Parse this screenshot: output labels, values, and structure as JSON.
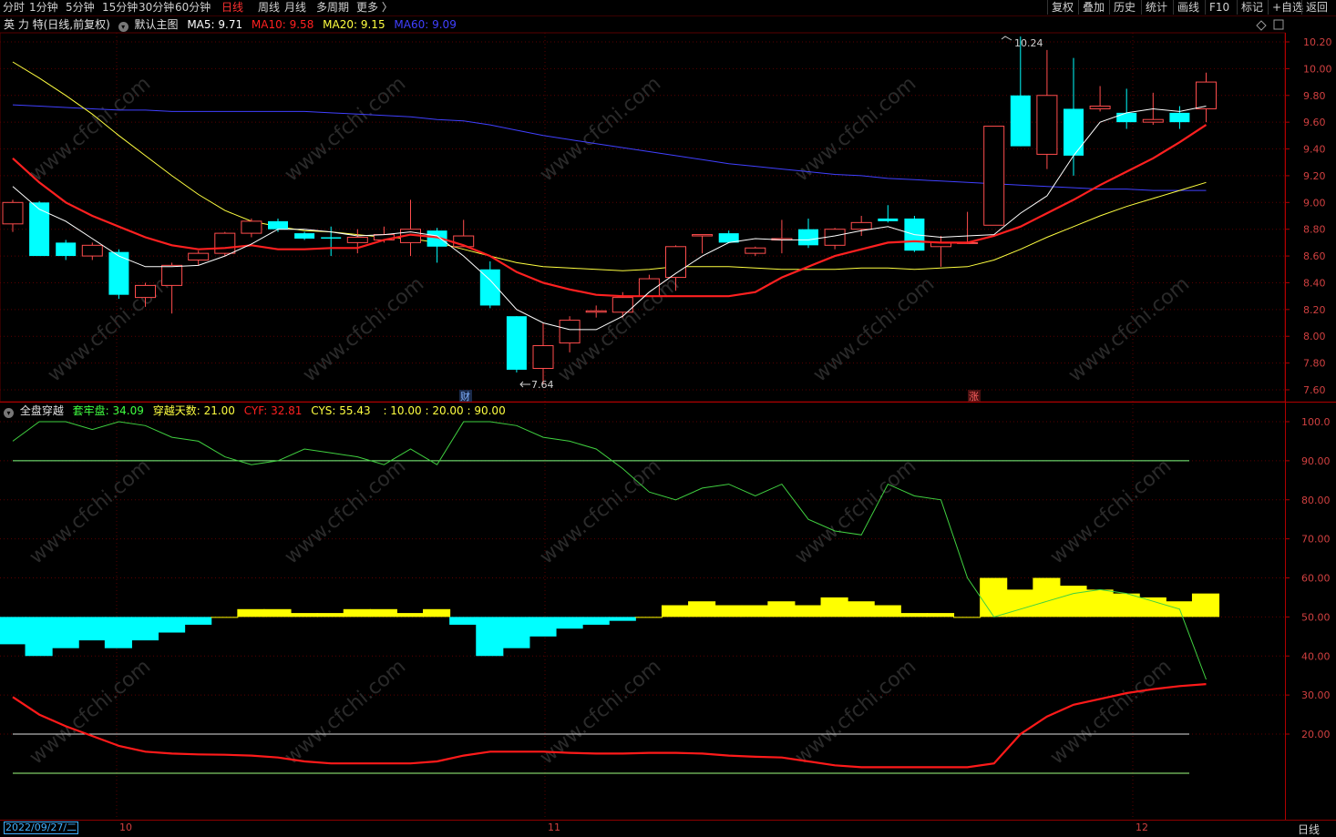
{
  "toolbar": {
    "periods": [
      "分时",
      "1分钟",
      "5分钟",
      "15分钟",
      "30分钟",
      "60分钟",
      "日线",
      "周线",
      "月线",
      "多周期",
      "更多 〉"
    ],
    "active_period": "日线",
    "right_buttons": [
      "复权",
      "叠加",
      "历史",
      "统计",
      "画线",
      "F10",
      "标记",
      "+自选",
      "返回"
    ]
  },
  "main_header": {
    "stock": "英 力 特(日线,前复权)",
    "template": "默认主图",
    "ma5": "MA5: 9.71",
    "ma10": "MA10: 9.58",
    "ma20": "MA20: 9.15",
    "ma60": "MA60: 9.09",
    "colors": {
      "ma5": "#ffffff",
      "ma10": "#ff2020",
      "ma20": "#ffff40",
      "ma60": "#4040ff"
    }
  },
  "indicator_header": {
    "name": "全盘穿越",
    "tl": "套牢盘: 34.09",
    "days": "穿越天数: 21.00",
    "cyf": "CYF: 32.81",
    "cys": "CYS: 55.43",
    "levels": ": 10.00 : 20.00 : 90.00"
  },
  "annotations": {
    "high": "10.24",
    "low": "7.64",
    "marker_cai": "财",
    "marker_zhang": "涨"
  },
  "axis": {
    "price_ticks": [
      "10.20",
      "10.00",
      "9.80",
      "9.60",
      "9.40",
      "9.20",
      "9.00",
      "8.80",
      "8.60",
      "8.40",
      "8.20",
      "8.00",
      "7.80",
      "7.60"
    ],
    "ind_ticks": [
      "100.0",
      "90.00",
      "80.00",
      "70.00",
      "60.00",
      "50.00",
      "40.00",
      "30.00",
      "20.00"
    ]
  },
  "status": {
    "date": "2022/09/27/二",
    "oct": "10",
    "nov": "11",
    "dec": "12",
    "period": "日线"
  },
  "chart_data": {
    "type": "candlestick",
    "y_range": [
      7.55,
      10.3
    ],
    "candles": [
      [
        8.84,
        9.0,
        8.78,
        9.02
      ],
      [
        9.0,
        8.6,
        8.6,
        9.01
      ],
      [
        8.7,
        8.6,
        8.57,
        8.72
      ],
      [
        8.6,
        8.68,
        8.57,
        8.7
      ],
      [
        8.63,
        8.31,
        8.28,
        8.65
      ],
      [
        8.29,
        8.38,
        8.22,
        8.4
      ],
      [
        8.38,
        8.53,
        8.17,
        8.55
      ],
      [
        8.57,
        8.62,
        8.53,
        8.64
      ],
      [
        8.62,
        8.77,
        8.6,
        8.78
      ],
      [
        8.77,
        8.86,
        8.74,
        8.88
      ],
      [
        8.86,
        8.8,
        8.78,
        8.88
      ],
      [
        8.77,
        8.73,
        8.72,
        8.78
      ],
      [
        8.74,
        8.73,
        8.6,
        8.82
      ],
      [
        8.7,
        8.74,
        8.62,
        8.8
      ],
      [
        8.72,
        8.76,
        8.7,
        8.82
      ],
      [
        8.7,
        8.8,
        8.6,
        9.02
      ],
      [
        8.79,
        8.67,
        8.55,
        8.81
      ],
      [
        8.67,
        8.75,
        8.67,
        8.87
      ],
      [
        8.5,
        8.23,
        8.21,
        8.56
      ],
      [
        8.15,
        7.75,
        7.73,
        8.15
      ],
      [
        7.76,
        7.93,
        7.64,
        8.1
      ],
      [
        7.95,
        8.12,
        7.88,
        8.15
      ],
      [
        8.18,
        8.19,
        8.14,
        8.23
      ],
      [
        8.18,
        8.29,
        8.14,
        8.33
      ],
      [
        8.3,
        8.43,
        8.3,
        8.46
      ],
      [
        8.44,
        8.67,
        8.34,
        8.68
      ],
      [
        8.75,
        8.76,
        8.62,
        8.76
      ],
      [
        8.77,
        8.7,
        8.7,
        8.79
      ],
      [
        8.62,
        8.66,
        8.6,
        8.67
      ],
      [
        8.72,
        8.73,
        8.62,
        8.87
      ],
      [
        8.8,
        8.68,
        8.66,
        8.88
      ],
      [
        8.68,
        8.8,
        8.65,
        8.81
      ],
      [
        8.8,
        8.85,
        8.75,
        8.9
      ],
      [
        8.88,
        8.86,
        8.85,
        8.98
      ],
      [
        8.88,
        8.64,
        8.63,
        8.9
      ],
      [
        8.67,
        8.7,
        8.52,
        8.75
      ],
      [
        8.7,
        8.7,
        8.69,
        8.93
      ],
      [
        8.83,
        9.57,
        8.83,
        9.57
      ],
      [
        9.8,
        9.42,
        9.42,
        10.24
      ],
      [
        9.36,
        9.8,
        9.25,
        10.14
      ],
      [
        9.7,
        9.35,
        9.2,
        10.08
      ],
      [
        9.7,
        9.72,
        9.68,
        9.87
      ],
      [
        9.67,
        9.6,
        9.55,
        9.85
      ],
      [
        9.6,
        9.62,
        9.58,
        9.82
      ],
      [
        9.67,
        9.6,
        9.55,
        9.72
      ],
      [
        9.7,
        9.9,
        9.6,
        9.97
      ]
    ],
    "ma5": [
      9.12,
      8.95,
      8.86,
      8.73,
      8.6,
      8.52,
      8.52,
      8.53,
      8.6,
      8.69,
      8.8,
      8.8,
      8.78,
      8.75,
      8.76,
      8.78,
      8.75,
      8.6,
      8.42,
      8.2,
      8.1,
      8.05,
      8.05,
      8.15,
      8.33,
      8.47,
      8.6,
      8.7,
      8.73,
      8.72,
      8.72,
      8.75,
      8.79,
      8.82,
      8.76,
      8.74,
      8.75,
      8.76,
      8.92,
      9.05,
      9.35,
      9.6,
      9.67,
      9.7,
      9.68,
      9.72
    ],
    "ma10": [
      9.33,
      9.15,
      9.0,
      8.9,
      8.82,
      8.74,
      8.68,
      8.65,
      8.66,
      8.68,
      8.65,
      8.65,
      8.66,
      8.66,
      8.72,
      8.76,
      8.74,
      8.68,
      8.6,
      8.48,
      8.4,
      8.35,
      8.31,
      8.3,
      8.3,
      8.3,
      8.3,
      8.3,
      8.33,
      8.44,
      8.52,
      8.6,
      8.65,
      8.7,
      8.71,
      8.7,
      8.7,
      8.75,
      8.82,
      8.92,
      9.02,
      9.13,
      9.23,
      9.33,
      9.45,
      9.58
    ],
    "ma20": [
      10.05,
      9.93,
      9.8,
      9.66,
      9.5,
      9.35,
      9.2,
      9.06,
      8.94,
      8.86,
      8.82,
      8.79,
      8.78,
      8.76,
      8.74,
      8.73,
      8.7,
      8.65,
      8.6,
      8.55,
      8.52,
      8.51,
      8.5,
      8.49,
      8.5,
      8.52,
      8.52,
      8.52,
      8.51,
      8.5,
      8.5,
      8.5,
      8.51,
      8.51,
      8.5,
      8.51,
      8.52,
      8.57,
      8.65,
      8.74,
      8.82,
      8.9,
      8.97,
      9.03,
      9.09,
      9.15
    ],
    "ma60": [
      9.73,
      9.72,
      9.71,
      9.7,
      9.69,
      9.69,
      9.68,
      9.68,
      9.68,
      9.68,
      9.68,
      9.68,
      9.67,
      9.66,
      9.65,
      9.64,
      9.62,
      9.61,
      9.58,
      9.54,
      9.5,
      9.47,
      9.44,
      9.41,
      9.38,
      9.35,
      9.32,
      9.29,
      9.27,
      9.25,
      9.23,
      9.21,
      9.2,
      9.18,
      9.17,
      9.16,
      9.15,
      9.14,
      9.13,
      9.12,
      9.11,
      9.1,
      9.1,
      9.09,
      9.09,
      9.09
    ],
    "ind_range": [
      0,
      105
    ],
    "green_line": [
      95,
      100,
      100,
      98,
      100,
      99,
      96,
      95,
      91,
      89,
      90,
      93,
      92,
      91,
      89,
      93,
      89,
      100,
      100,
      99,
      96,
      95,
      93,
      88,
      82,
      80,
      83,
      84,
      81,
      84,
      75,
      72,
      71,
      84,
      81,
      80,
      60,
      50,
      52,
      54,
      56,
      57,
      56,
      54,
      52,
      34
    ],
    "cys_bars": [
      43,
      40,
      42,
      44,
      42,
      44,
      46,
      48,
      50,
      52,
      52,
      51,
      51,
      52,
      52,
      51,
      52,
      48,
      40,
      42,
      45,
      47,
      48,
      49,
      50,
      53,
      54,
      53,
      53,
      54,
      53,
      55,
      54,
      53,
      51,
      51,
      50,
      60,
      57,
      60,
      58,
      57,
      56,
      55,
      54,
      56
    ],
    "red_line": [
      29.5,
      25,
      22,
      19.5,
      17,
      15.5,
      15,
      14.8,
      14.7,
      14.5,
      14,
      13,
      12.5,
      12.5,
      12.5,
      12.5,
      13,
      14.5,
      15.5,
      15.5,
      15.5,
      15.2,
      15,
      15,
      15.2,
      15.2,
      15,
      14.5,
      14.2,
      14,
      13,
      12,
      11.5,
      11.5,
      11.5,
      11.5,
      11.5,
      12.5,
      20,
      24.5,
      27.5,
      29,
      30.5,
      31.5,
      32.3,
      32.8
    ],
    "ind_levels": [
      90,
      20,
      10
    ]
  }
}
